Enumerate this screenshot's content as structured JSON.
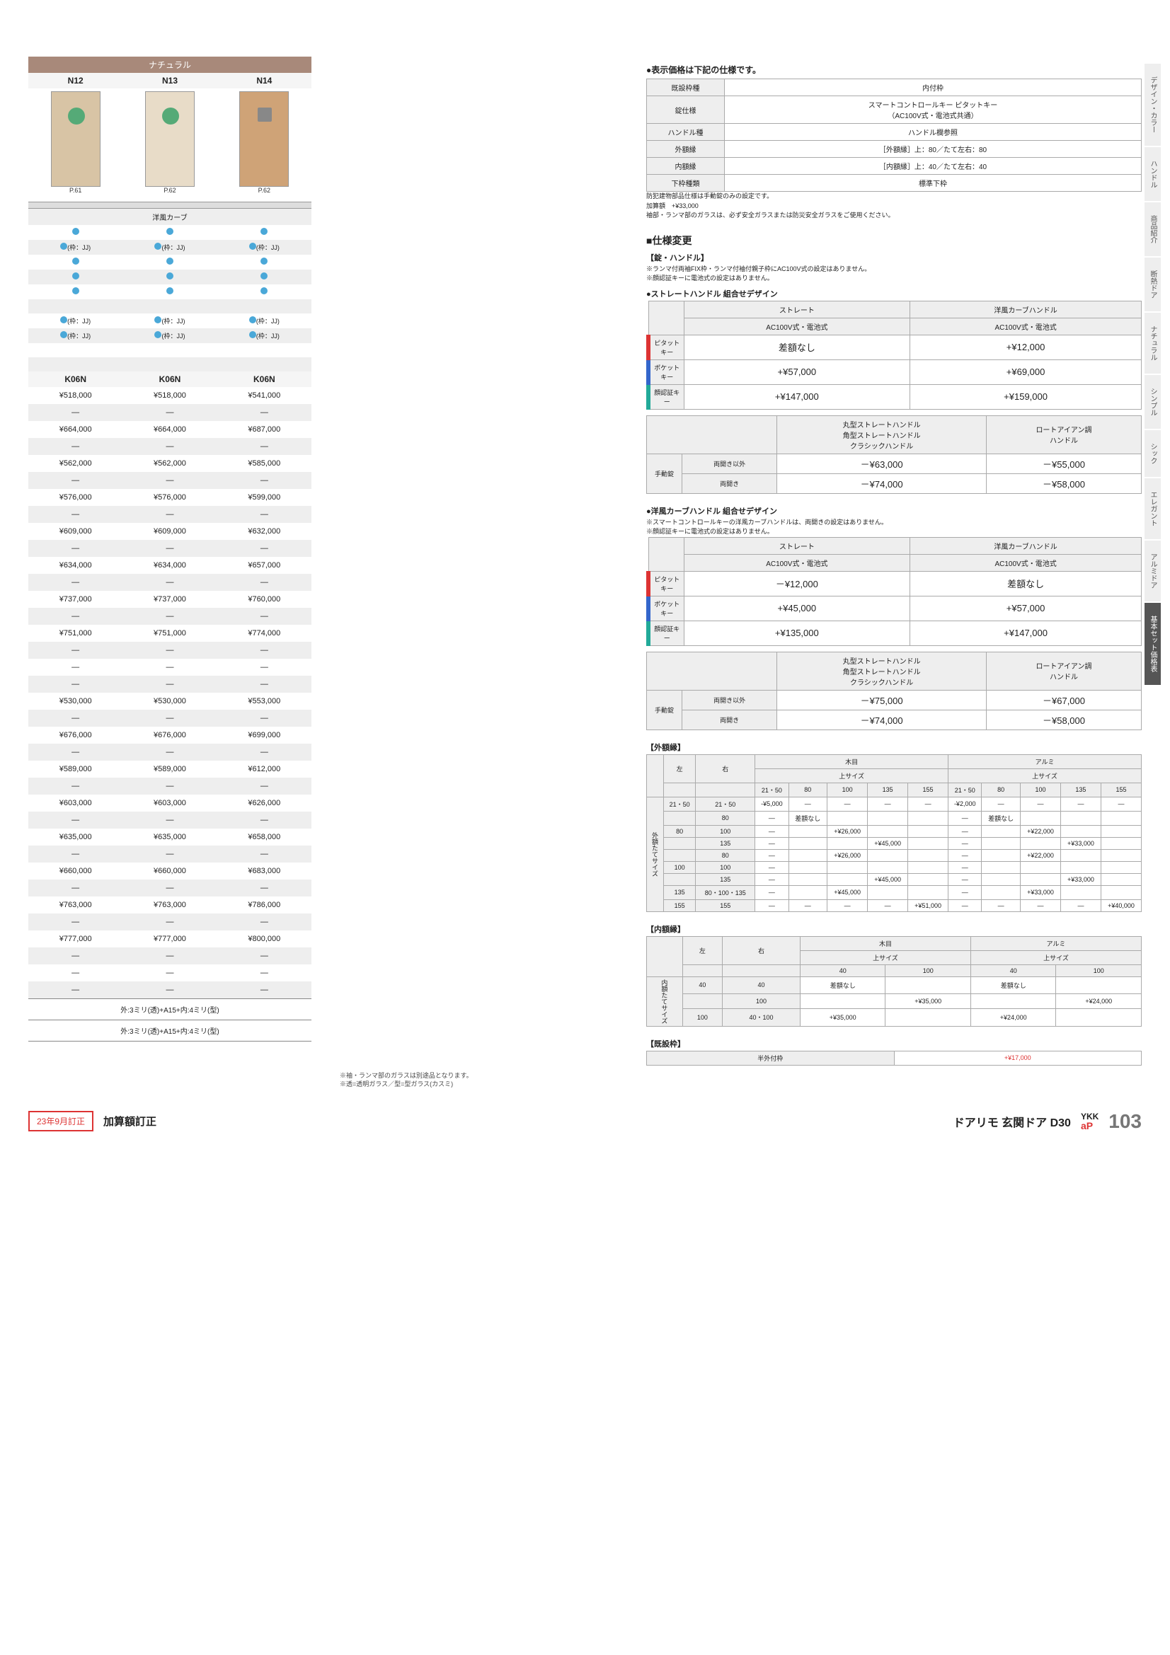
{
  "sidebar": [
    "デザイン・カラー",
    "ハンドル",
    "商品紹介",
    "断熱ドア",
    "ナチュラル",
    "シンプル",
    "シック",
    "エレガント",
    "アルミドア",
    "基本セット価格表"
  ],
  "header": {
    "natural": "ナチュラル",
    "cols": [
      "N12",
      "N13",
      "N14"
    ],
    "pages": [
      "P.61",
      "P.62",
      "P.62"
    ],
    "curve": "洋風カーブ",
    "frame": "(枠：JJ)",
    "k06": [
      "K06N",
      "K06N",
      "K06N"
    ]
  },
  "left_prices": [
    [
      "¥518,000",
      "¥518,000",
      "¥541,000"
    ],
    [
      "—",
      "—",
      "—"
    ],
    [
      "¥664,000",
      "¥664,000",
      "¥687,000"
    ],
    [
      "—",
      "—",
      "—"
    ],
    [
      "¥562,000",
      "¥562,000",
      "¥585,000"
    ],
    [
      "—",
      "—",
      "—"
    ],
    [
      "¥576,000",
      "¥576,000",
      "¥599,000"
    ],
    [
      "—",
      "—",
      "—"
    ],
    [
      "¥609,000",
      "¥609,000",
      "¥632,000"
    ],
    [
      "—",
      "—",
      "—"
    ],
    [
      "¥634,000",
      "¥634,000",
      "¥657,000"
    ],
    [
      "—",
      "—",
      "—"
    ],
    [
      "¥737,000",
      "¥737,000",
      "¥760,000"
    ],
    [
      "—",
      "—",
      "—"
    ],
    [
      "¥751,000",
      "¥751,000",
      "¥774,000"
    ],
    [
      "—",
      "—",
      "—"
    ],
    [
      "—",
      "—",
      "—"
    ],
    [
      "—",
      "—",
      "—"
    ],
    [
      "¥530,000",
      "¥530,000",
      "¥553,000"
    ],
    [
      "—",
      "—",
      "—"
    ],
    [
      "¥676,000",
      "¥676,000",
      "¥699,000"
    ],
    [
      "—",
      "—",
      "—"
    ],
    [
      "¥589,000",
      "¥589,000",
      "¥612,000"
    ],
    [
      "—",
      "—",
      "—"
    ],
    [
      "¥603,000",
      "¥603,000",
      "¥626,000"
    ],
    [
      "—",
      "—",
      "—"
    ],
    [
      "¥635,000",
      "¥635,000",
      "¥658,000"
    ],
    [
      "—",
      "—",
      "—"
    ],
    [
      "¥660,000",
      "¥660,000",
      "¥683,000"
    ],
    [
      "—",
      "—",
      "—"
    ],
    [
      "¥763,000",
      "¥763,000",
      "¥786,000"
    ],
    [
      "—",
      "—",
      "—"
    ],
    [
      "¥777,000",
      "¥777,000",
      "¥800,000"
    ],
    [
      "—",
      "—",
      "—"
    ],
    [
      "—",
      "—",
      "—"
    ],
    [
      "—",
      "—",
      "—"
    ]
  ],
  "glass_notes": [
    "外:3ミリ(透)+A15+内:4ミリ(型)",
    "外:3ミリ(透)+A15+内:4ミリ(型)"
  ],
  "glass_foot": [
    "※袖・ランマ部のガラスは別途品となります。",
    "※透=透明ガラス／型=型ガラス(カスミ)"
  ],
  "spec_title": "●表示価格は下記の仕様です。",
  "spec": [
    [
      "既設枠種",
      "内付枠"
    ],
    [
      "錠仕様",
      "スマートコントロールキー ピタットキー\n（AC100V式・電池式共通）"
    ],
    [
      "ハンドル種",
      "ハンドル欄参照"
    ],
    [
      "外額縁",
      "［外額縁］上：80／たて左右：80"
    ],
    [
      "内額縁",
      "［内額縁］上：40／たて左右：40"
    ],
    [
      "下枠種類",
      "標準下枠"
    ]
  ],
  "spec_notes": [
    "防犯建物部品仕様は手動錠のみの設定です。",
    "加算額　+¥33,000",
    "袖部・ランマ部のガラスは、必ず安全ガラスまたは防災安全ガラスをご使用ください。"
  ],
  "change_title": "■仕様変更",
  "lock_sub": "【錠・ハンドル】",
  "lock_notes": [
    "※ランマ付両袖FIX枠・ランマ付袖付親子枠にAC100V式の設定はありません。",
    "※顔認証キーに電池式の設定はありません。"
  ],
  "straight_title": "●ストレートハンドル 組合せデザイン",
  "combi_cols": [
    "ストレート",
    "洋風カーブハンドル"
  ],
  "combi_sub": "AC100V式・電池式",
  "combi1": [
    {
      "tag": "red",
      "label": "ピタットキー",
      "v": [
        "差額なし",
        "+¥12,000"
      ]
    },
    {
      "tag": "blue",
      "label": "ポケットキー",
      "v": [
        "+¥57,000",
        "+¥69,000"
      ]
    },
    {
      "tag": "green",
      "label": "顔認証キー",
      "v": [
        "+¥147,000",
        "+¥159,000"
      ]
    }
  ],
  "manual_cols": [
    "丸型ストレートハンドル\n角型ストレートハンドル\nクラシックハンドル",
    "ロートアイアン調\nハンドル"
  ],
  "manual1": [
    {
      "sub": "両開き以外",
      "v": [
        "－¥63,000",
        "－¥55,000"
      ]
    },
    {
      "sub": "両開き",
      "v": [
        "－¥74,000",
        "－¥58,000"
      ]
    }
  ],
  "curve_title": "●洋風カーブハンドル 組合せデザイン",
  "curve_notes": [
    "※スマートコントロールキーの洋風カーブハンドルは、両開きの設定はありません。",
    "※顔認証キーに電池式の設定はありません。"
  ],
  "combi2": [
    {
      "tag": "red",
      "label": "ピタットキー",
      "v": [
        "－¥12,000",
        "差額なし"
      ]
    },
    {
      "tag": "blue",
      "label": "ポケットキー",
      "v": [
        "+¥45,000",
        "+¥57,000"
      ]
    },
    {
      "tag": "green",
      "label": "顔認証キー",
      "v": [
        "+¥135,000",
        "+¥147,000"
      ]
    }
  ],
  "manual2": [
    {
      "sub": "両開き以外",
      "v": [
        "－¥75,000",
        "－¥67,000"
      ]
    },
    {
      "sub": "両開き",
      "v": [
        "－¥74,000",
        "－¥58,000"
      ]
    }
  ],
  "manual_label": "手動錠",
  "gaku_out": {
    "title": "【外額縁】",
    "cats": [
      "木目",
      "アルミ"
    ],
    "sub": "上サイズ",
    "left": "左",
    "right": "右",
    "sizes": [
      "21・50",
      "80",
      "100",
      "135",
      "155"
    ],
    "vlabel": "外額たてサイズ"
  },
  "gaku_out_rows": [
    {
      "l": "21・50",
      "r": "21・50",
      "m": [
        "-¥5,000",
        "—",
        "—",
        "—",
        "—"
      ],
      "a": [
        "-¥2,000",
        "—",
        "—",
        "—",
        "—"
      ]
    },
    {
      "l": "",
      "r": "80",
      "m": [
        "—",
        "差額なし",
        "",
        "",
        ""
      ],
      "a": [
        "—",
        "差額なし",
        "",
        "",
        ""
      ]
    },
    {
      "l": "80",
      "r": "100",
      "m": [
        "—",
        "",
        "+¥26,000",
        "",
        ""
      ],
      "a": [
        "—",
        "",
        "+¥22,000",
        "",
        ""
      ]
    },
    {
      "l": "",
      "r": "135",
      "m": [
        "—",
        "",
        "",
        "+¥45,000",
        ""
      ],
      "a": [
        "—",
        "",
        "",
        "+¥33,000",
        ""
      ]
    },
    {
      "l": "",
      "r": "80",
      "m": [
        "—",
        "",
        "+¥26,000",
        "",
        ""
      ],
      "a": [
        "—",
        "",
        "+¥22,000",
        "",
        ""
      ]
    },
    {
      "l": "100",
      "r": "100",
      "m": [
        "—",
        "",
        "",
        "",
        ""
      ],
      "a": [
        "—",
        "",
        "",
        "",
        ""
      ]
    },
    {
      "l": "",
      "r": "135",
      "m": [
        "—",
        "",
        "",
        "+¥45,000",
        ""
      ],
      "a": [
        "—",
        "",
        "",
        "+¥33,000",
        ""
      ]
    },
    {
      "l": "135",
      "r": "80・100・135",
      "m": [
        "—",
        "",
        "+¥45,000",
        "",
        ""
      ],
      "a": [
        "—",
        "",
        "+¥33,000",
        "",
        ""
      ]
    },
    {
      "l": "155",
      "r": "155",
      "m": [
        "—",
        "—",
        "—",
        "—",
        "+¥51,000"
      ],
      "a": [
        "—",
        "—",
        "—",
        "—",
        "+¥40,000"
      ]
    }
  ],
  "gaku_in": {
    "title": "【内額縁】",
    "cats": [
      "木目",
      "アルミ"
    ],
    "sub": "上サイズ",
    "sizes": [
      "40",
      "100"
    ],
    "vlabel": "内額たてサイズ"
  },
  "gaku_in_rows": [
    {
      "l": "40",
      "r": "40",
      "m": "差額なし",
      "m2": "",
      "a": "差額なし",
      "a2": ""
    },
    {
      "l": "",
      "r": "100",
      "m": "",
      "m2": "+¥35,000",
      "a": "",
      "a2": "+¥24,000"
    },
    {
      "l": "100",
      "r": "40・100",
      "m": "+¥35,000",
      "m2": "",
      "a": "+¥24,000",
      "a2": ""
    }
  ],
  "kisetsu": {
    "title": "【既設枠】",
    "label": "半外付枠",
    "val": "+¥17,000"
  },
  "footer": {
    "rev": "23年9月訂正",
    "revtxt": "加算額訂正",
    "prod": "ドアリモ 玄関ドア D30",
    "brand": "YKK",
    "ap": "aP",
    "page": "103"
  }
}
